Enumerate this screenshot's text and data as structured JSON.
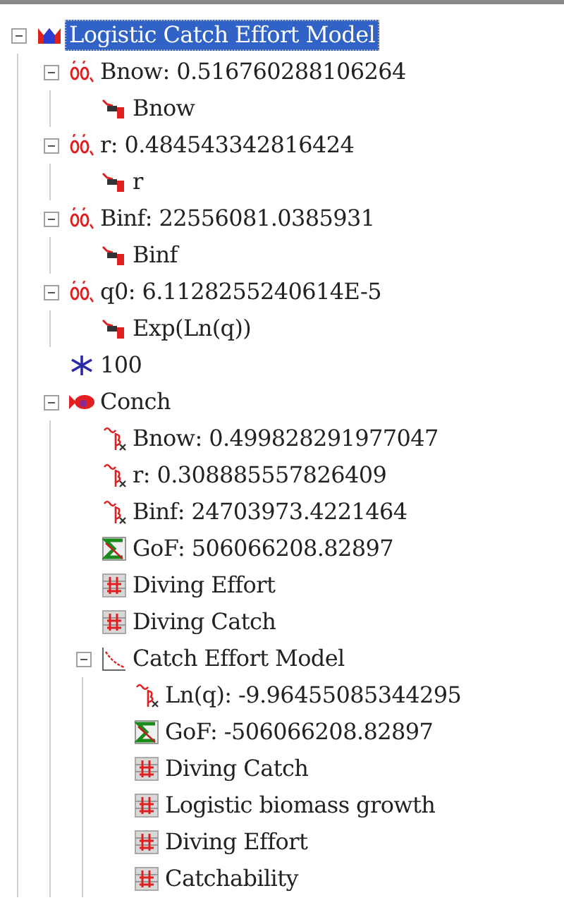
{
  "tree": [
    {
      "kind": "model",
      "label": "Logistic Catch Effort Model",
      "selected": true,
      "expanded": true,
      "children": [
        {
          "kind": "parameter",
          "label": "Bnow: 0.516760288106264",
          "selected": false,
          "expanded": true,
          "children": [
            {
              "kind": "variable",
              "label": "Bnow",
              "selected": false
            }
          ]
        },
        {
          "kind": "parameter",
          "label": "r: 0.484543342816424",
          "selected": false,
          "expanded": true,
          "children": [
            {
              "kind": "variable",
              "label": "r",
              "selected": false
            }
          ]
        },
        {
          "kind": "parameter",
          "label": "Binf: 22556081.0385931",
          "selected": false,
          "expanded": true,
          "children": [
            {
              "kind": "variable",
              "label": "Binf",
              "selected": false
            }
          ]
        },
        {
          "kind": "parameter",
          "label": "q0: 6.1128255240614E-5",
          "selected": false,
          "expanded": true,
          "children": [
            {
              "kind": "variable",
              "label": "Exp(Ln(q))",
              "selected": false
            }
          ]
        },
        {
          "kind": "constant",
          "label": "100",
          "selected": false
        },
        {
          "kind": "species",
          "label": "Conch",
          "selected": false,
          "expanded": true,
          "children": [
            {
              "kind": "estimate",
              "label": "Bnow: 0.499828291977047",
              "selected": false
            },
            {
              "kind": "estimate",
              "label": "r: 0.308885557826409",
              "selected": false
            },
            {
              "kind": "estimate",
              "label": "Binf: 24703973.4221464",
              "selected": false
            },
            {
              "kind": "gof",
              "label": "GoF: 506066208.82897",
              "selected": false
            },
            {
              "kind": "dataset",
              "label": "Diving Effort",
              "selected": false
            },
            {
              "kind": "dataset",
              "label": "Diving Catch",
              "selected": false
            },
            {
              "kind": "submodel",
              "label": "Catch Effort Model",
              "selected": false,
              "expanded": true,
              "children": [
                {
                  "kind": "estimate",
                  "label": "Ln(q): -9.96455085344295",
                  "selected": false
                },
                {
                  "kind": "gof",
                  "label": "GoF: -506066208.82897",
                  "selected": false
                },
                {
                  "kind": "dataset",
                  "label": "Diving Catch",
                  "selected": false
                },
                {
                  "kind": "dataset",
                  "label": "Logistic biomass growth",
                  "selected": false
                },
                {
                  "kind": "dataset",
                  "label": "Diving Effort",
                  "selected": false
                },
                {
                  "kind": "dataset",
                  "label": "Catchability",
                  "selected": false
                }
              ]
            }
          ]
        }
      ]
    }
  ]
}
